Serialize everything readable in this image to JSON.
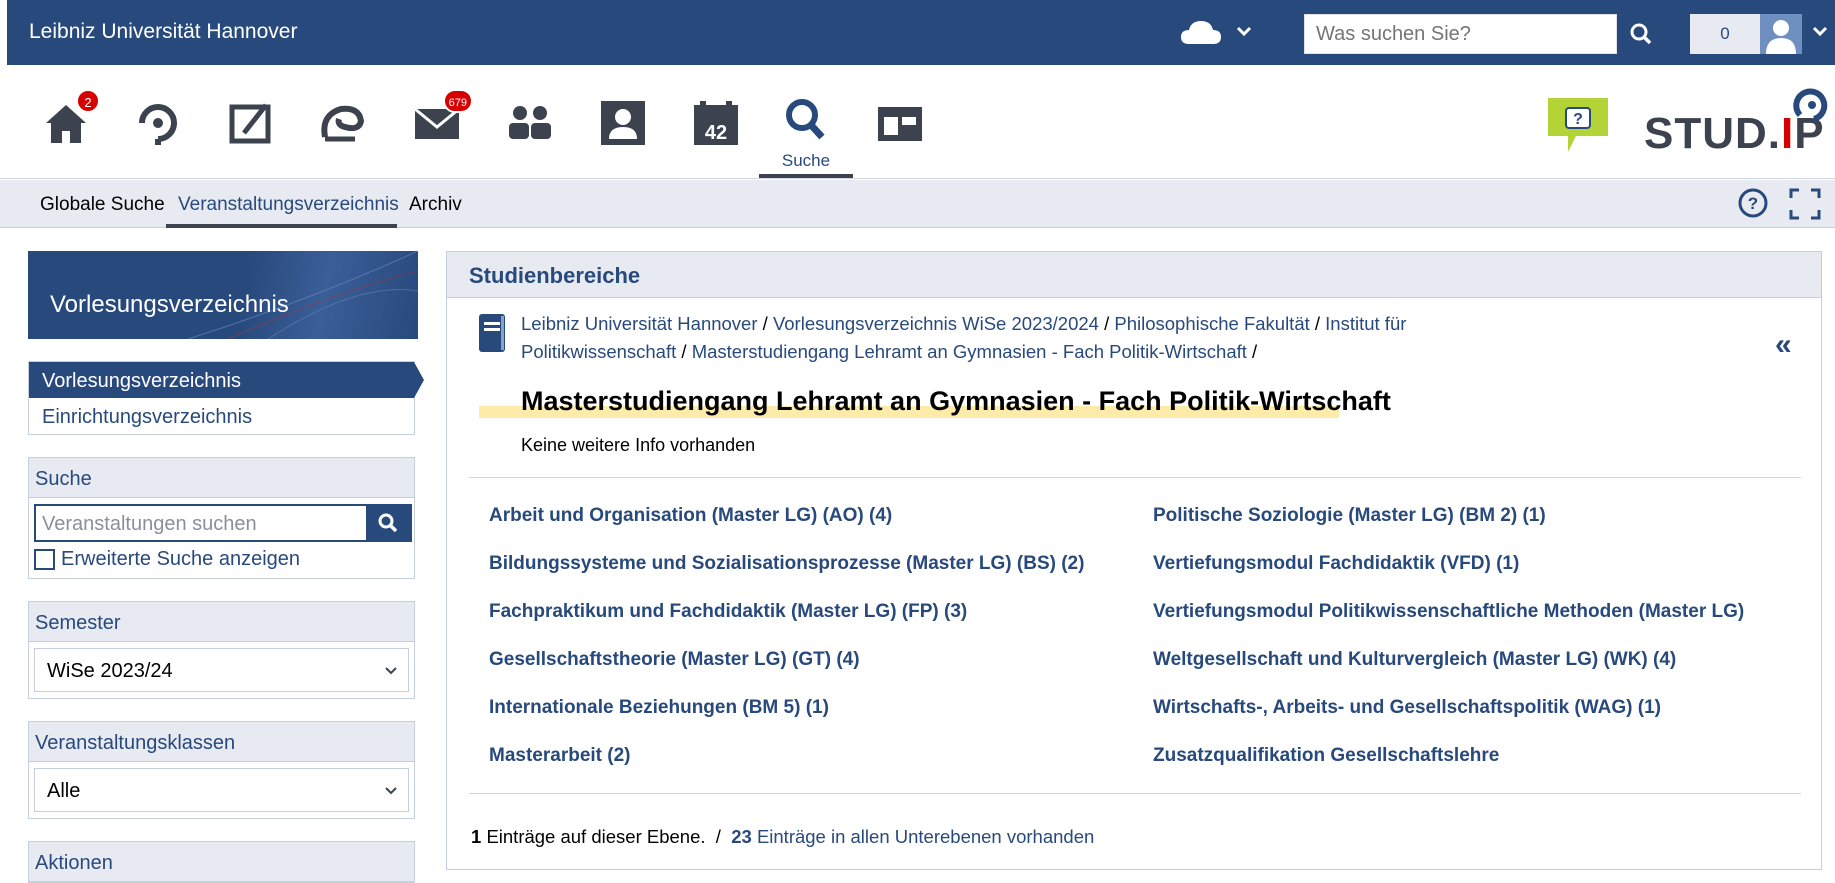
{
  "topbar": {
    "brand": "Leibniz Universität Hannover",
    "search_placeholder": "Was suchen Sie?",
    "counter": "0",
    "icons": [
      "cloud-icon",
      "chevron-down-icon",
      "search-icon",
      "avatar-icon"
    ]
  },
  "nav": {
    "home_badge": "2",
    "mail_badge": "679",
    "active_label": "Suche",
    "icons": [
      "home-icon",
      "workplace-icon",
      "courses-icon",
      "messenger-icon",
      "mail-icon",
      "community-icon",
      "profile-icon",
      "planner-icon",
      "search-icon",
      "tools-icon"
    ]
  },
  "subnav": {
    "tabs": [
      "Globale Suche",
      "Veranstaltungsverzeichnis",
      "Archiv"
    ],
    "active": "Veranstaltungsverzeichnis"
  },
  "sidebar": {
    "title": "Vorlesungsverzeichnis",
    "items": [
      {
        "label": "Vorlesungsverzeichnis",
        "active": true
      },
      {
        "label": "Einrichtungsverzeichnis",
        "active": false
      }
    ],
    "search": {
      "title": "Suche",
      "placeholder": "Veranstaltungen suchen",
      "extended": "Erweiterte Suche anzeigen"
    },
    "semester": {
      "title": "Semester",
      "value": "WiSe 2023/24"
    },
    "classes": {
      "title": "Veranstaltungsklassen",
      "value": "Alle"
    },
    "actions": {
      "title": "Aktionen"
    }
  },
  "main": {
    "heading": "Studienbereiche",
    "breadcrumb": [
      "Leibniz Universität Hannover",
      "Vorlesungsverzeichnis WiSe 2023/2024",
      "Philosophische Fakultät",
      "Institut für Politikwissenschaft",
      "Masterstudiengang Lehramt an Gymnasien - Fach Politik-Wirtschaft"
    ],
    "title": "Masterstudiengang Lehramt an Gymnasien - Fach Politik-Wirtschaft",
    "info": "Keine weitere Info vorhanden",
    "areas_left": [
      "Arbeit und Organisation (Master LG) (AO) (4)",
      "Bildungssysteme und Sozialisationsprozesse (Master LG) (BS) (2)",
      "Fachpraktikum und Fachdidaktik (Master LG) (FP) (3)",
      "Gesellschaftstheorie (Master LG) (GT) (4)",
      "Internationale Beziehungen (BM 5) (1)",
      "Masterarbeit (2)"
    ],
    "areas_right": [
      "Politische Soziologie (Master LG) (BM 2) (1)",
      "Vertiefungsmodul Fachdidaktik (VFD) (1)",
      "Vertiefungsmodul Politikwissenschaftliche Methoden (Master LG)",
      "Weltgesellschaft und Kulturvergleich (Master LG) (WK) (4)",
      "Wirtschafts-, Arbeits- und Gesellschaftspolitik (WAG) (1)",
      "Zusatzqualifikation Gesellschaftslehre"
    ],
    "footer": {
      "count_this": "1",
      "text_this": "Einträge auf dieser Ebene.",
      "sep": "/",
      "count_all": "23",
      "text_all": "Einträge in allen Unterebenen vorhanden"
    }
  }
}
